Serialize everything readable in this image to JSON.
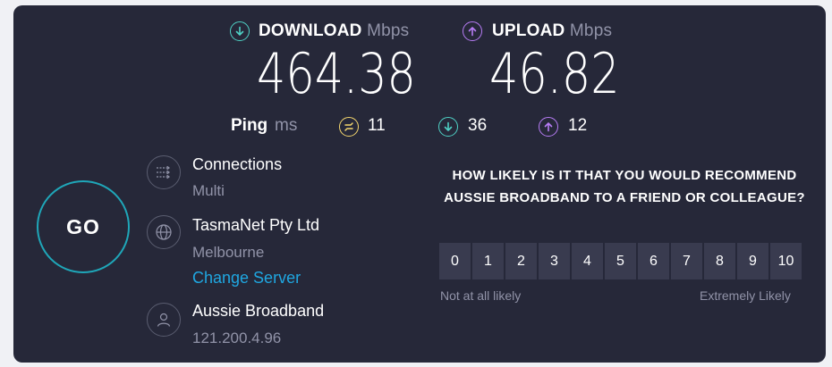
{
  "download": {
    "label": "DOWNLOAD",
    "unit": "Mbps",
    "value": "464.38"
  },
  "upload": {
    "label": "UPLOAD",
    "unit": "Mbps",
    "value": "46.82"
  },
  "ping": {
    "label": "Ping",
    "unit": "ms",
    "idle": "11",
    "download": "36",
    "upload": "12"
  },
  "go_label": "GO",
  "connections": {
    "title": "Connections",
    "value": "Multi"
  },
  "server": {
    "name": "TasmaNet Pty Ltd",
    "location": "Melbourne",
    "change_label": "Change Server"
  },
  "provider": {
    "name": "Aussie Broadband",
    "ip": "121.200.4.96"
  },
  "survey": {
    "question": "HOW LIKELY IS IT THAT YOU WOULD RECOMMEND AUSSIE BROADBAND TO A FRIEND OR COLLEAGUE?",
    "scale": [
      "0",
      "1",
      "2",
      "3",
      "4",
      "5",
      "6",
      "7",
      "8",
      "9",
      "10"
    ],
    "low_label": "Not at all likely",
    "high_label": "Extremely Likely"
  },
  "colors": {
    "accent_teal": "#4fd1c5",
    "accent_purple": "#b77cf5",
    "ping_yellow": "#f5d76e",
    "link_blue": "#1fa7e1",
    "go_ring": "#1fa7b9"
  },
  "icons": {
    "download": "arrow-down-circle-icon",
    "upload": "arrow-up-circle-icon",
    "jitter": "jitter-icon",
    "connections": "connections-icon",
    "globe": "globe-icon",
    "user": "user-icon"
  }
}
